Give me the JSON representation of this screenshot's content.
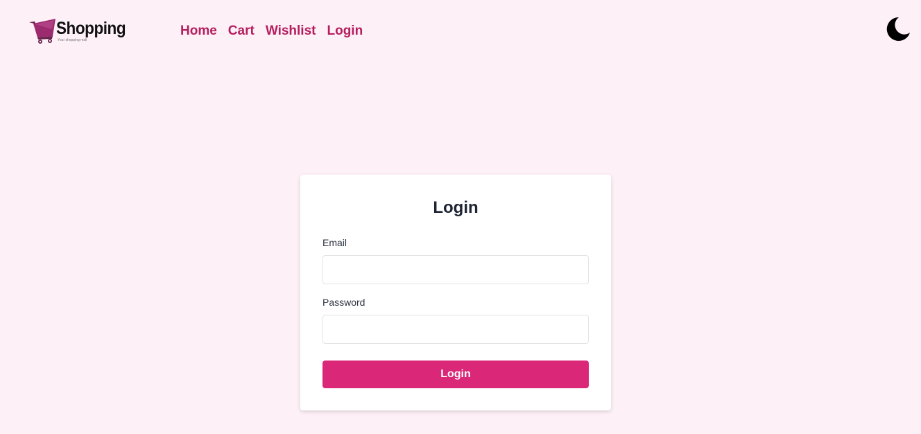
{
  "brand": {
    "name": "Shopping",
    "tagline": "Your shopping mall",
    "cart_icon": "shopping-cart-icon",
    "accent_color": "#9b2a6e"
  },
  "nav": {
    "items": [
      {
        "label": "Home"
      },
      {
        "label": "Cart"
      },
      {
        "label": "Wishlist"
      },
      {
        "label": "Login"
      }
    ],
    "link_color": "#b51d5e"
  },
  "theme_toggle": {
    "icon": "moon-icon"
  },
  "login_form": {
    "title": "Login",
    "email_label": "Email",
    "email_value": "",
    "password_label": "Password",
    "password_value": "",
    "submit_label": "Login",
    "submit_color": "#db2777"
  },
  "colors": {
    "page_background": "#fdf0f6",
    "card_background": "#ffffff"
  }
}
